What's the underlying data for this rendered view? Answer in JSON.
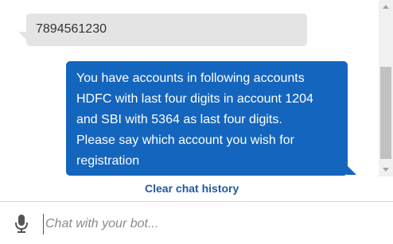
{
  "messages": {
    "user": {
      "text": "7894561230"
    },
    "bot": {
      "lines": [
        "You have accounts in following accounts",
        "HDFC with last four digits in account 1204",
        "and SBI with 5364 as last four digits.",
        "Please say which account you wish for",
        "registration"
      ]
    }
  },
  "actions": {
    "clear_history": "Clear chat history"
  },
  "input": {
    "placeholder": "Chat with your bot...",
    "value": ""
  },
  "icons": {
    "mic": "microphone-icon",
    "scroll_up": "scroll-up-arrow-icon",
    "scroll_down": "scroll-down-arrow-icon"
  },
  "colors": {
    "bot_bubble": "#1465bd",
    "user_bubble": "#e4e4e4",
    "link": "#1f5a9e"
  }
}
